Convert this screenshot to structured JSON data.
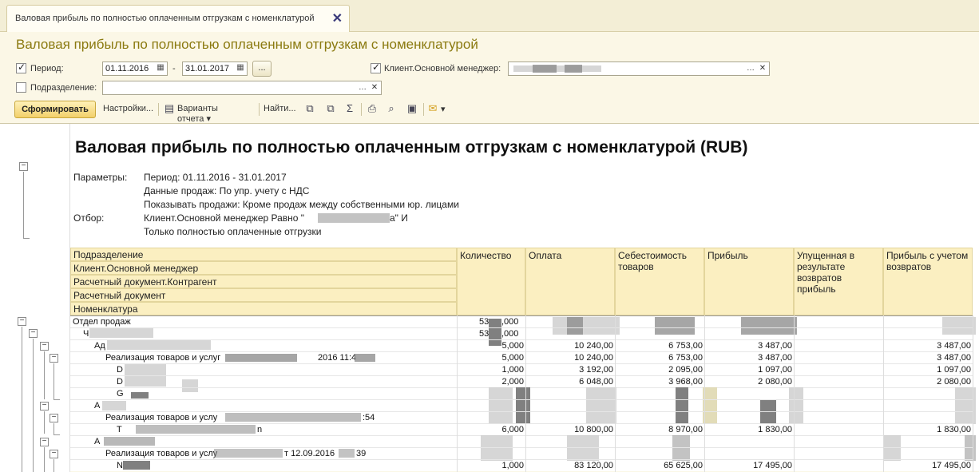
{
  "tab": {
    "title": "Валовая прибыль по полностью оплаченным отгрузкам с номенклатурой"
  },
  "form_title": "Валовая прибыль по полностью оплаченным отгрузкам с номенклатурой",
  "filters": {
    "period_label": "Период:",
    "period_from": "01.11.2016",
    "period_sep": "-",
    "period_to": "31.01.2017",
    "period_dots": "...",
    "client_label": "Клиент.Основной менеджер:",
    "client_value": "",
    "division_label": "Подразделение:",
    "division_value": ""
  },
  "toolbar": {
    "generate": "Сформировать",
    "settings": "Настройки...",
    "variants": "Варианты отчета",
    "find": "Найти..."
  },
  "report": {
    "title": "Валовая прибыль по полностью оплаченным отгрузкам с номенклатурой (RUB)",
    "params_label": "Параметры:",
    "param1": "Период: 01.11.2016 - 31.01.2017",
    "param2": "Данные продаж: По упр. учету с НДС",
    "param3": "Показывать продажи: Кроме продаж между собственными юр. лицами",
    "filter_label": "Отбор:",
    "filter1": "Клиент.Основной менеджер Равно \"",
    "filter1_end": "а\" И",
    "filter2": "Только полностью оплаченные отгрузки",
    "headers": {
      "group1": "Подразделение",
      "group2": "Клиент.Основной менеджер",
      "group3": "Расчетный документ.Контрагент",
      "group4": "Расчетный документ",
      "group5": "Номенклатура",
      "qty": "Количество",
      "payment": "Оплата",
      "cost": "Себестоимость товаров",
      "profit": "Прибыль",
      "lost": "Упущенная в результате возвратов прибыль",
      "profit_ret": "Прибыль с учетом возвратов"
    },
    "rows": [
      {
        "name": "Отдел продаж",
        "qty": "53",
        "qty2": ",000",
        "payment": "",
        "cost": "",
        "profit": "",
        "lost": "",
        "profit_ret": ""
      },
      {
        "name": "Ч",
        "qty": "53",
        "qty2": ",000",
        "payment": "",
        "cost": "",
        "profit": "",
        "lost": "",
        "profit_ret": ""
      },
      {
        "name": "Ад",
        "qty": "5,000",
        "payment": "10 240,00",
        "cost": "6 753,00",
        "profit": "3 487,00",
        "lost": "",
        "profit_ret": "3 487,00"
      },
      {
        "name": "Реализация товаров и услуг",
        "suffix": "2016 11:4",
        "qty": "5,000",
        "payment": "10 240,00",
        "cost": "6 753,00",
        "profit": "3 487,00",
        "lost": "",
        "profit_ret": "3 487,00"
      },
      {
        "name": "D",
        "qty": "1,000",
        "payment": "3 192,00",
        "cost": "2 095,00",
        "profit": "1 097,00",
        "lost": "",
        "profit_ret": "1 097,00"
      },
      {
        "name": "D",
        "qty": "2,000",
        "payment": "6 048,00",
        "cost": "3 968,00",
        "profit": "2 080,00",
        "lost": "",
        "profit_ret": "2 080,00"
      },
      {
        "name": "G",
        "qty": "",
        "payment": "",
        "cost": "",
        "profit": "",
        "lost": "",
        "profit_ret": ""
      },
      {
        "name": "А",
        "qty": "",
        "payment": "",
        "cost": "",
        "profit": "",
        "lost": "",
        "profit_ret": ""
      },
      {
        "name": "Реализация товаров и услу",
        "suffix": ":54",
        "qty": "",
        "payment": "",
        "cost": "",
        "profit": "",
        "lost": "",
        "profit_ret": ""
      },
      {
        "name": "Т",
        "suffix": "n",
        "qty": "6,000",
        "payment": "10 800,00",
        "cost": "8 970,00",
        "profit": "1 830,00",
        "lost": "",
        "profit_ret": "1 830,00"
      },
      {
        "name": "А",
        "qty": "",
        "payment": "",
        "cost": "",
        "profit": "",
        "lost": "",
        "profit_ret": ""
      },
      {
        "name": "Реализация товаров и услу",
        "suffix": "т 12.09.2016",
        "suffix2": "39",
        "qty": "",
        "payment": "",
        "cost": "",
        "profit": "",
        "lost": "",
        "profit_ret": ""
      },
      {
        "name": "N",
        "qty": "1,000",
        "payment": "83 120,00",
        "cost": "65 625,00",
        "profit": "17 495,00",
        "lost": "",
        "profit_ret": "17 495,00"
      }
    ]
  }
}
